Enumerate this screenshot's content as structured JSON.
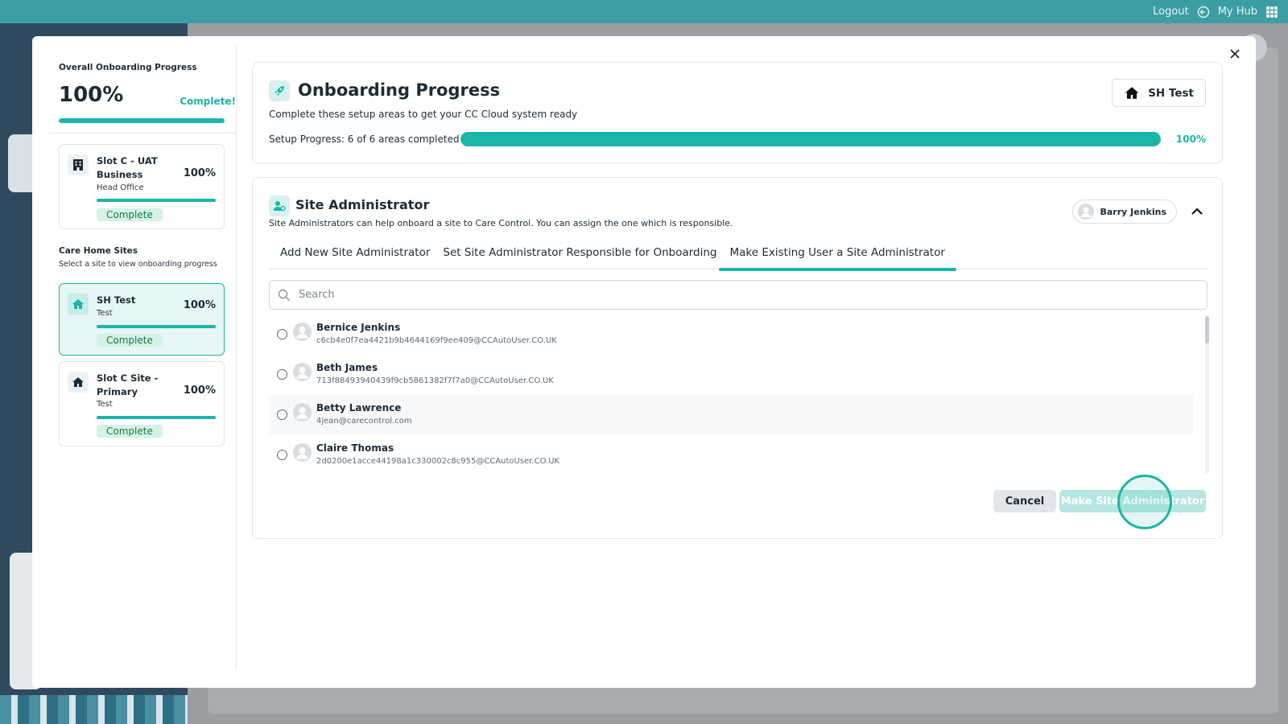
{
  "topbar": {
    "logout_label": "Logout",
    "hub_label": "My Hub"
  },
  "modal": {
    "left": {
      "overall_label": "Overall Onboarding Progress",
      "overall_pct": "100%",
      "overall_status": "Complete!",
      "overall_progress": 1.0,
      "business_card": {
        "name": "Slot C - UAT Business",
        "pct": "100%",
        "sub": "Head Office",
        "badge": "Complete"
      },
      "care_home_title": "Care Home Sites",
      "care_home_sub": "Select a site to view onboarding progress",
      "sites": [
        {
          "name": "SH Test",
          "pct": "100%",
          "sub": "Test",
          "badge": "Complete"
        },
        {
          "name": "Slot C Site - Primary",
          "pct": "100%",
          "sub": "Test",
          "badge": "Complete"
        }
      ]
    },
    "onboarding": {
      "title": "Onboarding Progress",
      "subtitle": "Complete these setup areas to get your CC Cloud system ready",
      "site_chip": "SH Test",
      "setup_label": "Setup Progress: 6 of 6 areas completed",
      "setup_pct": "100%",
      "setup_progress": 1.0
    },
    "site_admin": {
      "title": "Site Administrator",
      "subtitle": "Site Administrators can help onboard a site to Care Control. You can assign the one which is responsible.",
      "assignee": "Barry Jenkins",
      "tabs": [
        "Add New Site Administrator",
        "Set Site Administrator Responsible for Onboarding",
        "Make Existing User a Site Administrator"
      ],
      "search_placeholder": "Search",
      "users": [
        {
          "name": "Bernice Jenkins",
          "email": "c6cb4e0f7ea4421b9b4644169f9ee409@CCAutoUser.CO.UK"
        },
        {
          "name": "Beth James",
          "email": "713f88493940439f9cb5861382f7f7a0@CCAutoUser.CO.UK"
        },
        {
          "name": "Betty Lawrence",
          "email": "4jean@carecontrol.com"
        },
        {
          "name": "Claire Thomas",
          "email": "2d0200e1acce44198a1c330002c8c955@CCAutoUser.CO.UK"
        }
      ],
      "cancel_label": "Cancel",
      "make_label": "Make Site Administrator"
    }
  },
  "colors": {
    "accent": "#1bb5a8",
    "topbar": "#3c9ea3",
    "badge_bg": "#d4f2e6",
    "badge_text": "#1d7a46"
  }
}
